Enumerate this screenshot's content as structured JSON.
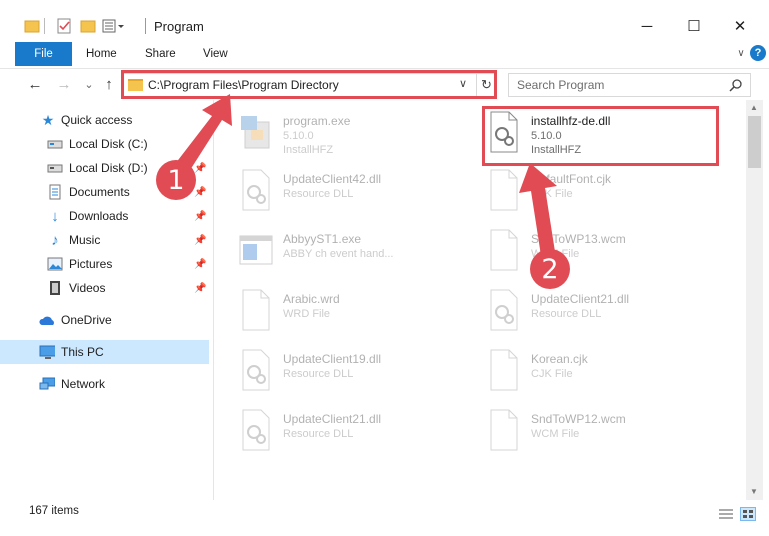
{
  "window": {
    "title": "Program",
    "minimize_label": "─",
    "maximize_label": "☐",
    "close_label": "✕"
  },
  "ribbon": {
    "tabs": [
      "File",
      "Home",
      "Share",
      "View"
    ],
    "expand_label": "∨",
    "help_label": "?"
  },
  "nav": {
    "back_label": "←",
    "forward_label": "→",
    "recent_label": "⌄",
    "up_label": "↑",
    "address": "C:\\Program Files\\Program Directory",
    "address_dropdown": "∨",
    "refresh_label": "↻",
    "search_placeholder": "Search Program"
  },
  "sidebar": {
    "quick_access": "Quick access",
    "items": [
      {
        "label": "Local Disk (C:)",
        "icon": "drive-icon",
        "pinned": true
      },
      {
        "label": "Local Disk (D:)",
        "icon": "drive-icon",
        "pinned": true
      },
      {
        "label": "Documents",
        "icon": "documents-icon",
        "pinned": true
      },
      {
        "label": "Downloads",
        "icon": "downloads-icon",
        "pinned": true
      },
      {
        "label": "Music",
        "icon": "music-icon",
        "pinned": true
      },
      {
        "label": "Pictures",
        "icon": "pictures-icon",
        "pinned": true
      },
      {
        "label": "Videos",
        "icon": "videos-icon",
        "pinned": true
      }
    ],
    "onedrive": "OneDrive",
    "this_pc": "This PC",
    "network": "Network"
  },
  "files": {
    "left": [
      {
        "name": "program.exe",
        "line2": "5.10.0",
        "line3": "InstallHFZ",
        "icon": "exe-setup-icon"
      },
      {
        "name": "UpdateClient42.dll",
        "line2": "Resource DLL",
        "line3": "",
        "icon": "dll-icon"
      },
      {
        "name": "AbbyyST1.exe",
        "line2": "ABBY ch event hand...",
        "line3": "",
        "icon": "exe-window-icon"
      },
      {
        "name": "Arabic.wrd",
        "line2": "WRD File",
        "line3": "",
        "icon": "blank-file-icon"
      },
      {
        "name": "UpdateClient19.dll",
        "line2": "Resource DLL",
        "line3": "",
        "icon": "dll-icon"
      },
      {
        "name": "UpdateClient21.dll",
        "line2": "Resource DLL",
        "line3": "",
        "icon": "dll-icon"
      }
    ],
    "right": [
      {
        "name": "installhfz-de.dll",
        "line2": "5.10.0",
        "line3": "InstallHFZ",
        "icon": "dll-icon"
      },
      {
        "name": "DefaultFont.cjk",
        "line2": "CJK File",
        "line3": "",
        "icon": "blank-file-icon"
      },
      {
        "name": "SndToWP13.wcm",
        "line2": "WCM File",
        "line3": "",
        "icon": "blank-file-icon"
      },
      {
        "name": "UpdateClient21.dll",
        "line2": "Resource DLL",
        "line3": "",
        "icon": "dll-icon"
      },
      {
        "name": "Korean.cjk",
        "line2": "CJK File",
        "line3": "",
        "icon": "blank-file-icon"
      },
      {
        "name": "SndToWP12.wcm",
        "line2": "WCM File",
        "line3": "",
        "icon": "blank-file-icon"
      }
    ]
  },
  "status": {
    "count": "167 items"
  },
  "callouts": [
    "1",
    "2"
  ],
  "colors": {
    "accent": "#1979ca",
    "highlight": "#e04b54",
    "selection": "#cce8ff"
  }
}
